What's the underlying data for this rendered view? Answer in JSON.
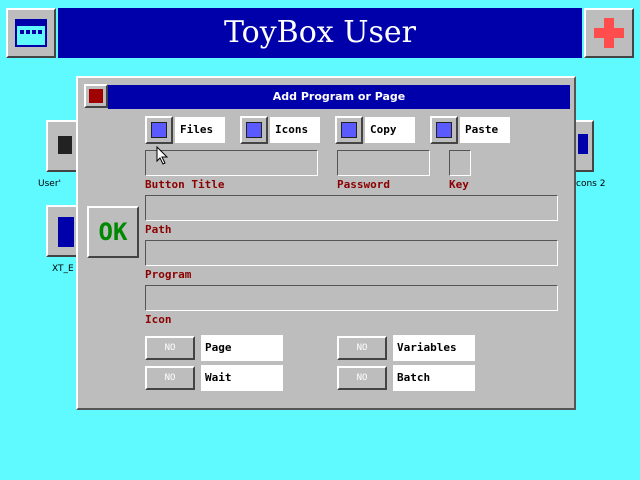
{
  "app": {
    "title": "ToyBox User"
  },
  "background_groups": [
    {
      "label": "User'"
    },
    {
      "label": "XT_E"
    },
    {
      "label": "cons 2"
    }
  ],
  "dialog": {
    "title": "Add Program or Page",
    "checks": [
      {
        "label": "Files",
        "accel": "F"
      },
      {
        "label": "Icons",
        "accel": "I"
      },
      {
        "label": "Copy",
        "accel": "C"
      },
      {
        "label": "Paste",
        "accel": "P"
      }
    ],
    "fields": {
      "button_title": {
        "label": "Button Title",
        "value": ""
      },
      "password": {
        "label": "Password",
        "value": ""
      },
      "key": {
        "label": "Key",
        "value": ""
      },
      "path": {
        "label": "Path",
        "value": ""
      },
      "program": {
        "label": "Program",
        "value": ""
      },
      "icon": {
        "label": "Icon",
        "value": ""
      }
    },
    "ok_label": "OK",
    "toggles": [
      {
        "state": "NO",
        "label": "Page"
      },
      {
        "state": "NO",
        "label": "Wait"
      },
      {
        "state": "NO",
        "label": "Variables"
      },
      {
        "state": "NO",
        "label": "Batch"
      }
    ]
  },
  "colors": {
    "desktop": "#5ffaff",
    "titlebar": "#0000aa",
    "dialog_face": "#bdbdbd",
    "label_red": "#8b0000",
    "ok_green": "#008800"
  }
}
